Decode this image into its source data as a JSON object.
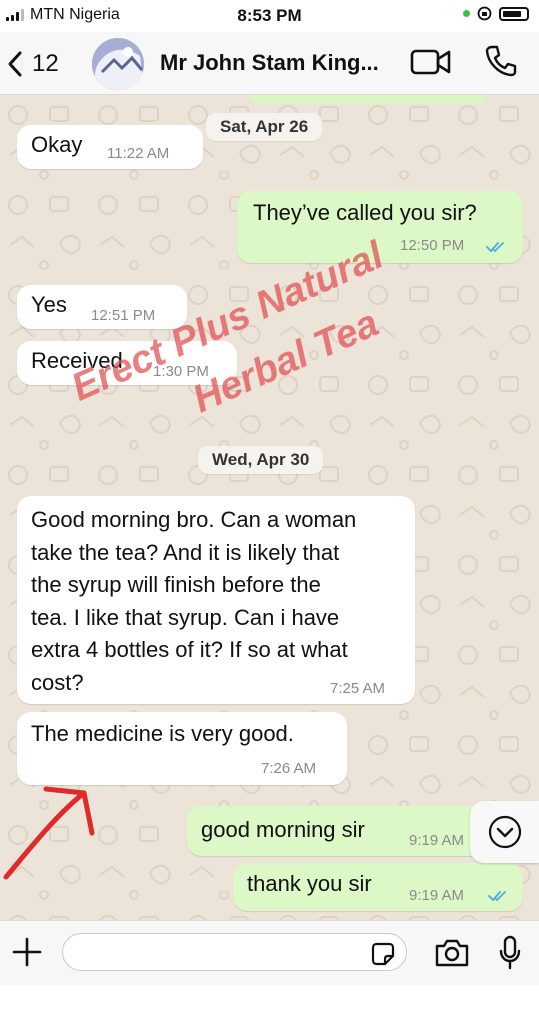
{
  "status": {
    "carrier": "MTN Nigeria",
    "time": "8:53 PM"
  },
  "header": {
    "back_count": "12",
    "contact_name": "Mr John Stam King...",
    "icons": [
      "chevron-left-icon",
      "video-call-icon",
      "phone-icon"
    ]
  },
  "dates": {
    "first": "Sat, Apr 26",
    "second": "Wed, Apr 30"
  },
  "messages": [
    {
      "direction": "incoming",
      "text": "Okay",
      "time": "11:22 AM"
    },
    {
      "direction": "outgoing",
      "text": "They’ve called you sir?",
      "time": "12:50 PM",
      "status": "read"
    },
    {
      "direction": "incoming",
      "text": "Yes",
      "time": "12:51 PM"
    },
    {
      "direction": "incoming",
      "text": "Received",
      "time": "1:30 PM"
    },
    {
      "direction": "incoming",
      "lines": [
        "Good morning bro. Can a woman",
        "take the tea?  And it is likely that",
        "the syrup will finish before the",
        "tea. I like that syrup. Can i have",
        "extra 4 bottles of it? If so at what",
        "cost?"
      ],
      "time": "7:25 AM"
    },
    {
      "direction": "incoming",
      "text": "The medicine is very good.",
      "time": "7:26 AM"
    },
    {
      "direction": "outgoing",
      "text": "good morning sir",
      "time": "9:19 AM"
    },
    {
      "direction": "outgoing",
      "text": "thank you sir",
      "time": "9:19 AM",
      "status": "read"
    }
  ],
  "watermark": {
    "line1": "Erect Plus Natural",
    "line2": "Herbal Tea"
  },
  "input": {
    "placeholder": "",
    "icons": [
      "plus-icon",
      "sticker-icon",
      "camera-icon",
      "microphone-icon"
    ]
  },
  "colors": {
    "incoming_bubble": "#ffffff",
    "outgoing_bubble": "#dcf8c6",
    "read_ticks": "#4fa8e8",
    "chat_wallpaper": "#ece4d8",
    "watermark": "#e24e52",
    "annotation_arrow": "#e02a2a"
  }
}
